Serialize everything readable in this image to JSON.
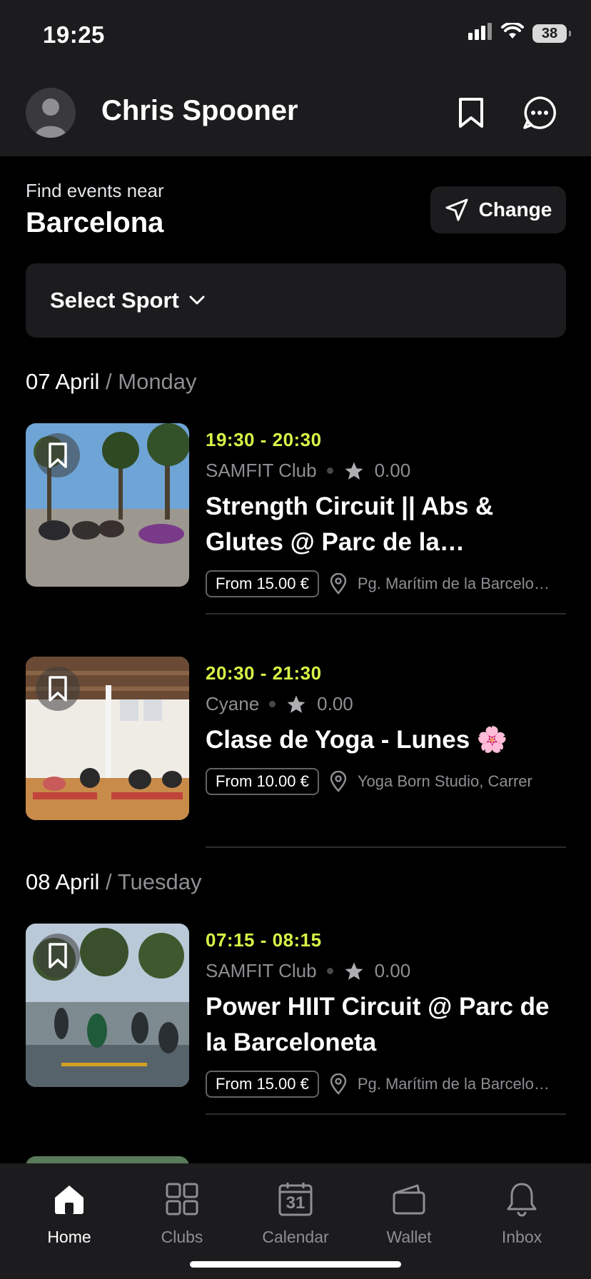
{
  "status": {
    "time": "19:25",
    "battery": "38"
  },
  "header": {
    "user_name": "Chris Spooner"
  },
  "location": {
    "label": "Find events near",
    "city": "Barcelona",
    "change_label": "Change"
  },
  "filter": {
    "sport_label": "Select Sport"
  },
  "days": [
    {
      "date": "07 April",
      "weekday": "/ Monday"
    },
    {
      "date": "08 April",
      "weekday": "/ Tuesday"
    }
  ],
  "events": [
    {
      "time": "19:30 - 20:30",
      "club": "SAMFIT Club",
      "rating": "0.00",
      "title": "Strength Circuit || Abs & Glutes @ Parc de la Barceloneta",
      "price": "From 15.00 €",
      "location": "Pg. Marítim de la Barceloneta"
    },
    {
      "time": "20:30 - 21:30",
      "club": "Cyane",
      "rating": "0.00",
      "title": "Clase de Yoga - Lunes 🌸",
      "price": "From 10.00 €",
      "location": "Yoga Born Studio, Carrer"
    },
    {
      "time": "07:15 - 08:15",
      "club": "SAMFIT Club",
      "rating": "0.00",
      "title": "Power HIIT Circuit @ Parc de la Barceloneta",
      "price": "From 15.00 €",
      "location": "Pg. Marítim de la Barceloneta"
    }
  ],
  "tabs": [
    {
      "label": "Home",
      "icon": "home-icon",
      "active": true
    },
    {
      "label": "Clubs",
      "icon": "grid-icon",
      "active": false
    },
    {
      "label": "Calendar",
      "icon": "calendar-icon",
      "calendar_day": "31",
      "active": false
    },
    {
      "label": "Wallet",
      "icon": "wallet-icon",
      "active": false
    },
    {
      "label": "Inbox",
      "icon": "bell-icon",
      "active": false
    }
  ],
  "colors": {
    "accent_time": "#d7f547",
    "background": "#000000",
    "surface": "#1c1c1e"
  }
}
